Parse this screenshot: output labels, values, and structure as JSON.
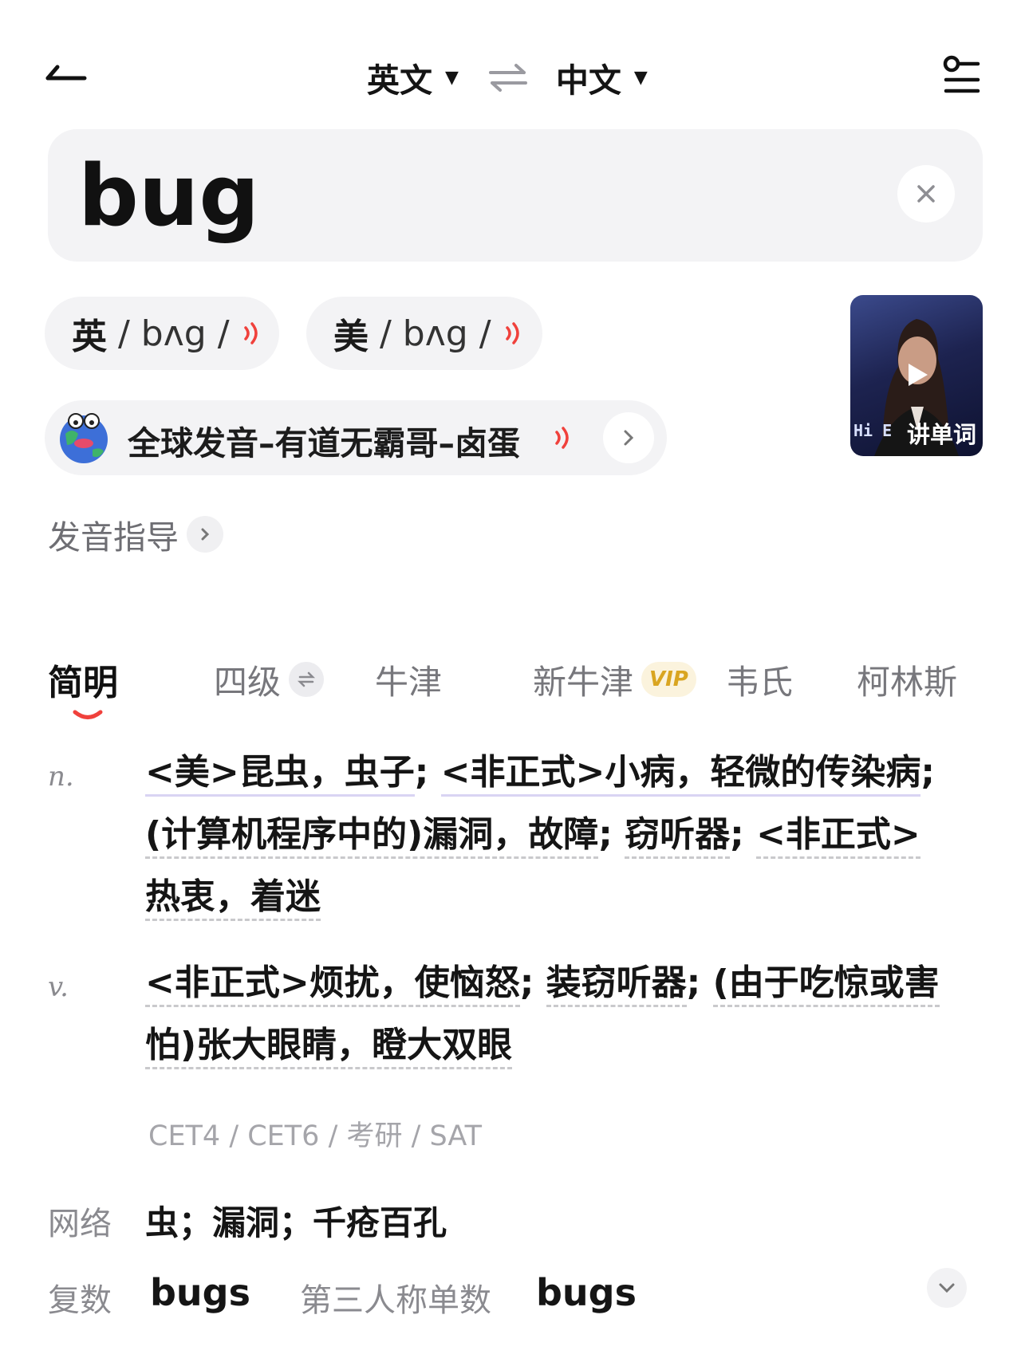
{
  "header": {
    "source_lang": "英文",
    "target_lang": "中文"
  },
  "search": {
    "query": "bug"
  },
  "pronunciation": {
    "uk": {
      "region": "英",
      "phonetic": "/ bʌg /"
    },
    "us": {
      "region": "美",
      "phonetic": "/ bʌg /"
    },
    "global_label": "全球发音–有道无霸哥–卤蛋",
    "guide_label": "发音指导"
  },
  "video": {
    "watermark": "Hi E",
    "label": "讲单词"
  },
  "tabs": [
    {
      "label": "简明"
    },
    {
      "label": "四级"
    },
    {
      "label": "牛津"
    },
    {
      "label": "新牛津",
      "badge": "VIP"
    },
    {
      "label": "韦氏"
    },
    {
      "label": "柯林斯"
    }
  ],
  "definitions": {
    "noun": {
      "pos": "n.",
      "parts": [
        "<美>昆虫，虫子",
        "; ",
        "<非正式>小病，轻微的传染病",
        "; ",
        "(计算机程序中的)漏洞，故障",
        "; ",
        "窃听器",
        "; ",
        "<非正式>热衷，着迷"
      ]
    },
    "verb": {
      "pos": "v.",
      "parts": [
        "<非正式>烦扰，使恼怒",
        "; ",
        "装窃听器",
        "; ",
        "(由于吃惊或害怕)张大眼睛，瞪大双眼"
      ]
    }
  },
  "exam_tags": "CET4 / CET6 / 考研 / SAT",
  "web": {
    "label": "网络",
    "value": "虫；漏洞；千疮百孔"
  },
  "forms": {
    "plural_label": "复数",
    "plural_value": "bugs",
    "third_person_label": "第三人称单数",
    "third_person_value": "bugs"
  },
  "colors": {
    "accent_red": "#f0413c",
    "vip_gold": "#d9a521",
    "pill_bg": "#f3f3f5"
  }
}
